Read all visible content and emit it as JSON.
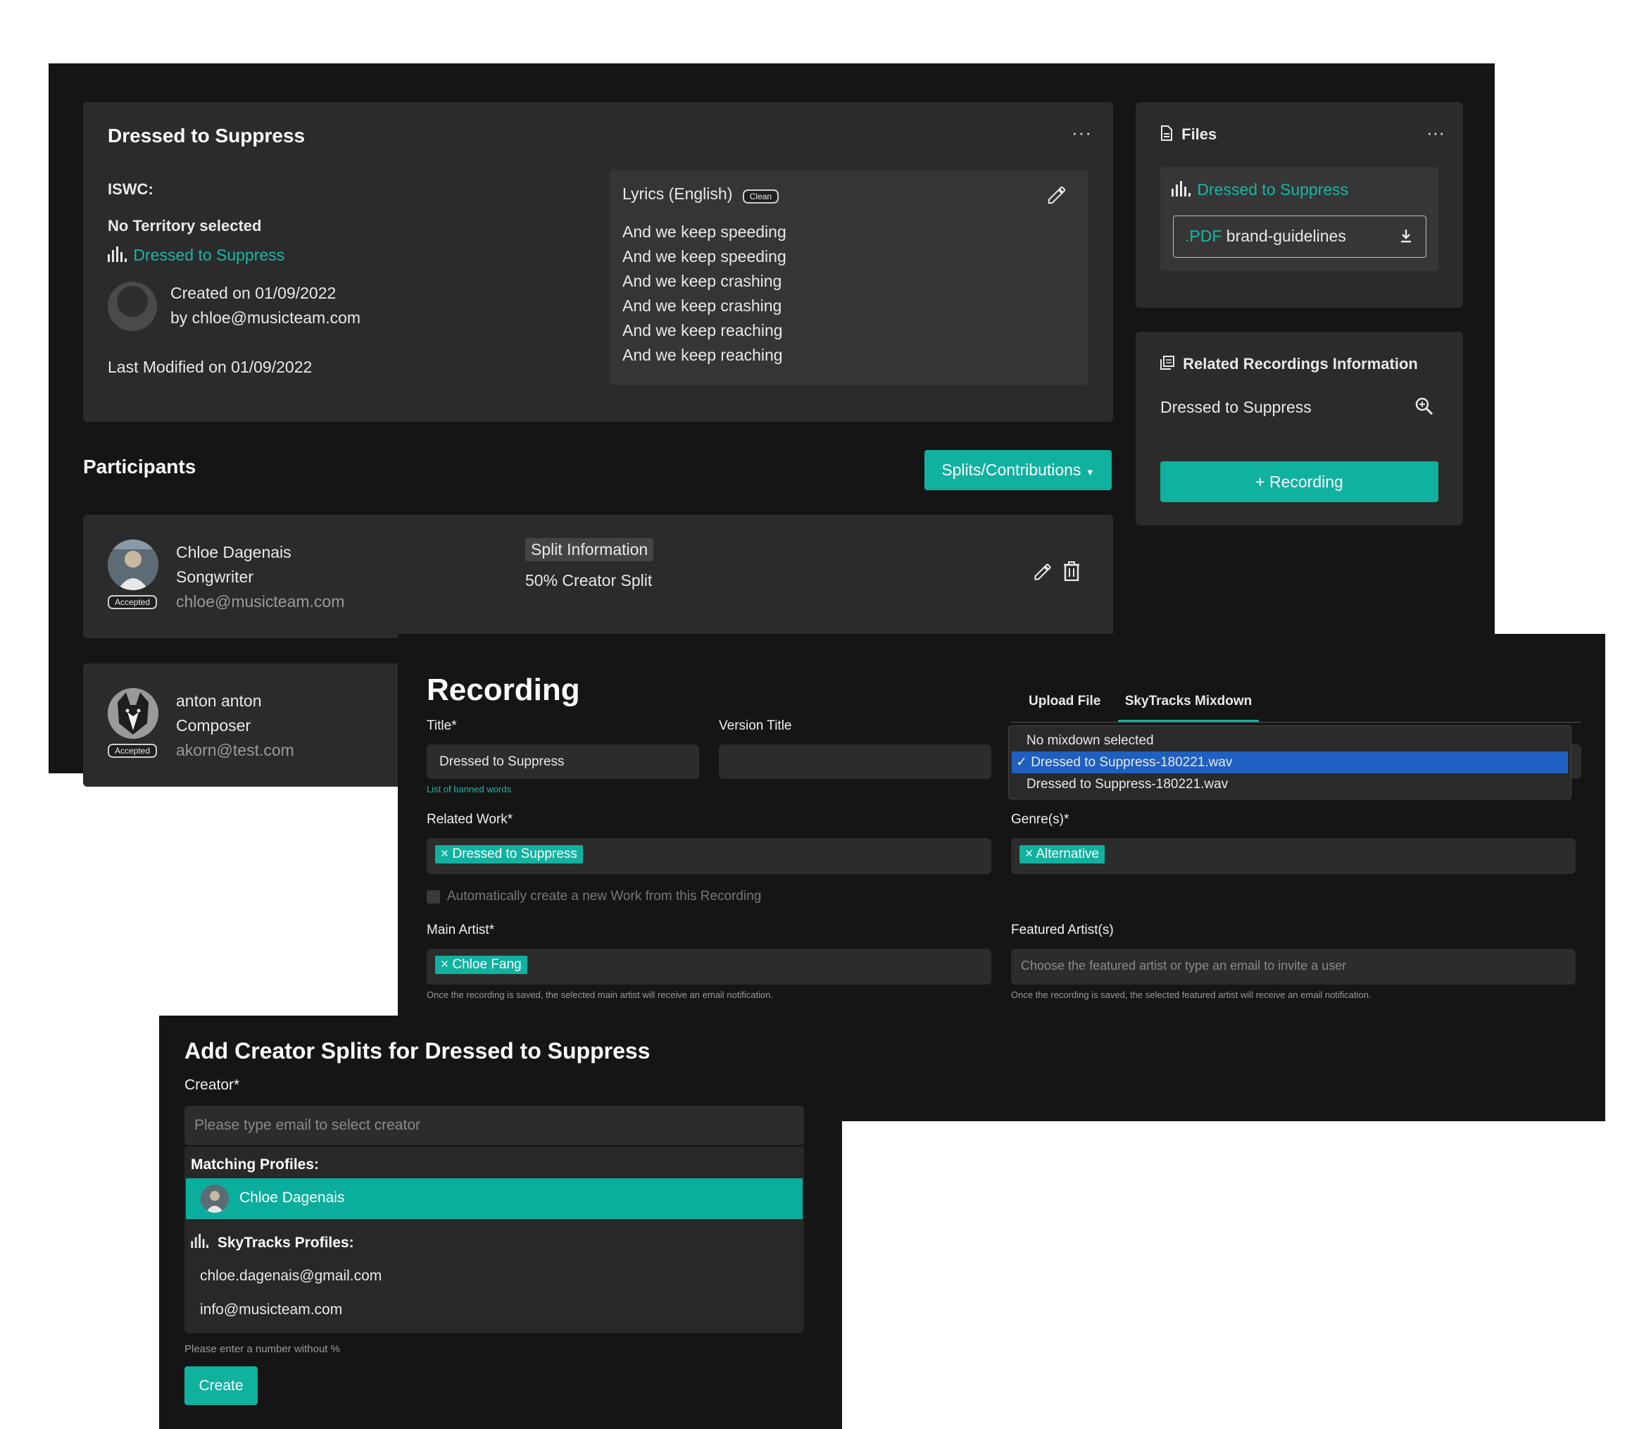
{
  "work": {
    "title": "Dressed to Suppress",
    "iswc_label": "ISWC:",
    "territory": "No Territory selected",
    "linked_work": "Dressed to Suppress",
    "created_line1": "Created on 01/09/2022",
    "created_line2": "by chloe@musicteam.com",
    "last_modified": "Last Modified on 01/09/2022",
    "lyrics_label": "Lyrics (English)",
    "lyrics_badge": "Clean",
    "lyrics": [
      "And we keep speeding",
      "And we keep speeding",
      "And we keep crashing",
      "And we keep crashing",
      "And we keep reaching",
      "And we keep reaching"
    ]
  },
  "files": {
    "title": "Files",
    "track_name": "Dressed to Suppress",
    "file_ext": ".PDF",
    "file_name": "brand-guidelines"
  },
  "related": {
    "title": "Related Recordings Information",
    "recording_name": "Dressed to Suppress",
    "add_button": "+ Recording"
  },
  "participants": {
    "title": "Participants",
    "splits_button": "Splits/Contributions",
    "items": [
      {
        "name": "Chloe Dagenais",
        "role": "Songwriter",
        "email": "chloe@musicteam.com",
        "status": "Accepted",
        "split_header": "Split Information",
        "split_value": "50% Creator Split"
      },
      {
        "name": "anton anton",
        "role": "Composer",
        "email": "akorn@test.com",
        "status": "Accepted"
      }
    ]
  },
  "recording": {
    "heading": "Recording",
    "title_label": "Title*",
    "title_value": "Dressed to Suppress",
    "banned_words_link": "List of banned words",
    "version_label": "Version Title",
    "version_value": "",
    "tabs": [
      "Upload File",
      "SkyTracks Mixdown"
    ],
    "mixdown_options": [
      "No mixdown selected",
      "Dressed to Suppress-180221.wav",
      "Dressed to Suppress-180221.wav"
    ],
    "mixdown_selected_mark": "✓",
    "related_work_label": "Related Work*",
    "related_work_tag": "Dressed to Suppress",
    "genre_label": "Genre(s)*",
    "genre_tag": "Alternative",
    "auto_create_label": "Automatically create a new Work from this Recording",
    "main_artist_label": "Main Artist*",
    "main_artist_tag": "Chloe Fang",
    "main_artist_hint": "Once the recording is saved, the selected main artist will receive an email notification.",
    "featured_label": "Featured Artist(s)",
    "featured_placeholder": "Choose the featured artist or type an email to invite a user",
    "featured_hint": "Once the recording is saved, the selected featured artist will receive an email notification.",
    "tag_remove": "×"
  },
  "splits": {
    "heading": "Add Creator Splits for Dressed to Suppress",
    "creator_label": "Creator*",
    "creator_placeholder": "Please type email to select creator",
    "matching_header": "Matching Profiles:",
    "matching_items": [
      "Chloe Dagenais"
    ],
    "skytracks_header": "SkyTracks Profiles:",
    "skytracks_items": [
      "chloe.dagenais@gmail.com",
      "info@musicteam.com"
    ],
    "number_hint": "Please enter a number without %",
    "create_button": "Create"
  },
  "colors": {
    "accent": "#11b19f",
    "selected_option": "#1f5fc0",
    "panel": "#151515",
    "card": "#2b2b2b"
  }
}
